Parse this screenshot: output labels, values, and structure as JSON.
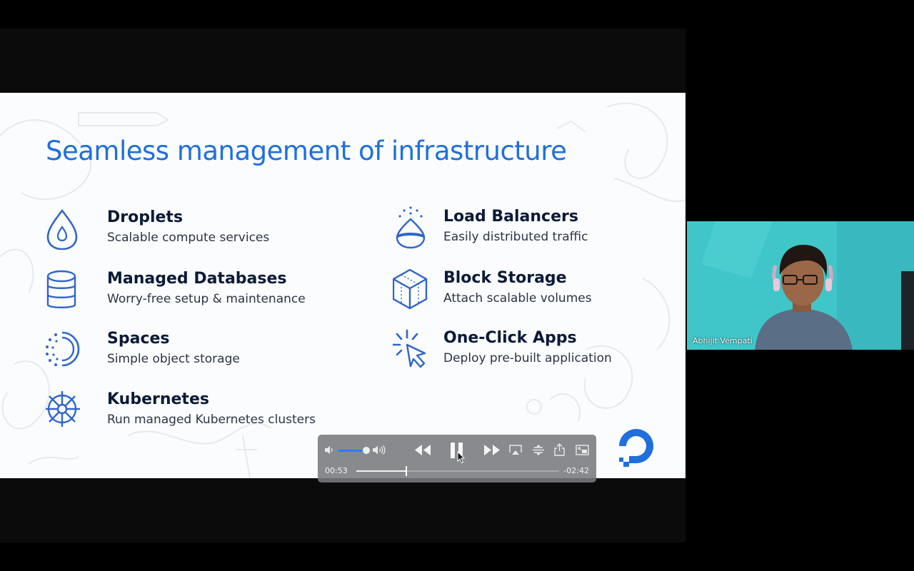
{
  "slide": {
    "title": "Seamless management of infrastructure",
    "features": [
      {
        "name": "Droplets",
        "description": "Scalable compute services",
        "icon": "droplet-icon"
      },
      {
        "name": "Managed Databases",
        "description": "Worry-free setup & maintenance",
        "icon": "database-icon"
      },
      {
        "name": "Spaces",
        "description": "Simple object storage",
        "icon": "spaces-icon"
      },
      {
        "name": "Kubernetes",
        "description": "Run managed Kubernetes clusters",
        "icon": "kubernetes-icon"
      },
      {
        "name": "Load Balancers",
        "description": "Easily distributed traffic",
        "icon": "load-balancer-icon"
      },
      {
        "name": "Block Storage",
        "description": "Attach scalable volumes",
        "icon": "block-storage-icon"
      },
      {
        "name": "One-Click Apps",
        "description": "Deploy pre-built application",
        "icon": "one-click-icon"
      }
    ],
    "logo": "digitalocean-logo",
    "colors": {
      "title": "#1f6fdc",
      "icon": "#2f66c8",
      "text_dark": "#0b1a37"
    }
  },
  "player": {
    "elapsed": "00:53",
    "remaining": "-02:42",
    "progress_fraction": 0.246,
    "volume_fraction": 1.0,
    "state": "playing",
    "colors": {
      "accent": "#2f7bff"
    }
  },
  "webcam": {
    "participant_name": "Abhijit Vempati"
  }
}
